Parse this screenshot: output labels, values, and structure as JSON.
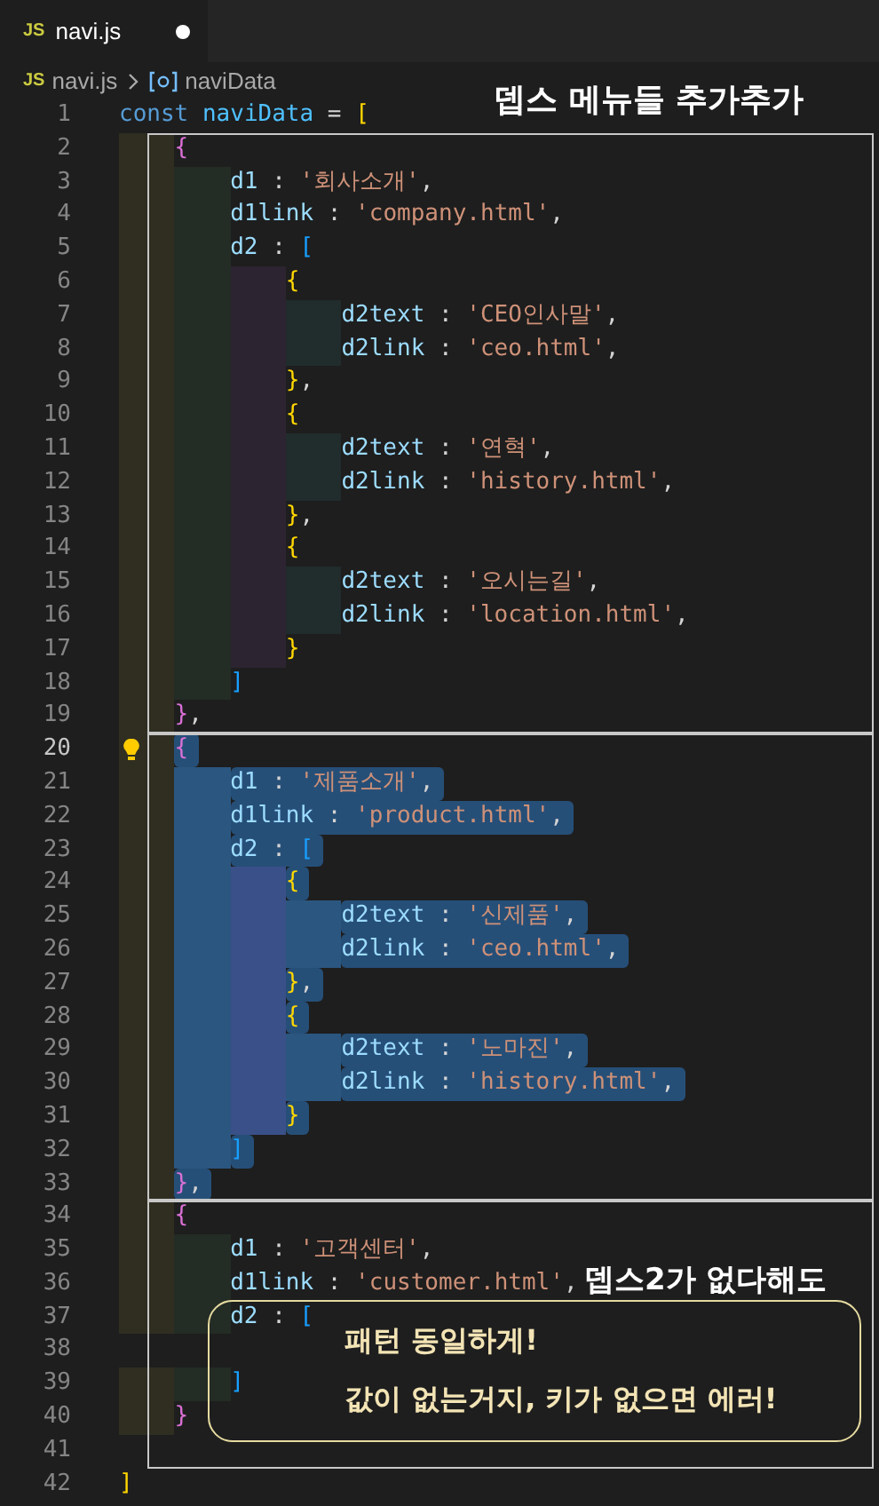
{
  "tab": {
    "badge": "JS",
    "label": "navi.js",
    "modified": true,
    "selected": true
  },
  "breadcrumb": {
    "badge": "JS",
    "file": "navi.js",
    "symbol": "naviData"
  },
  "blocks": [
    {
      "outlined": false,
      "lines": [
        {
          "number": "1",
          "selected": false,
          "current": false,
          "tokens": [
            {
              "text": "const",
              "kind": "keyword"
            },
            {
              "text": " naviData",
              "kind": "variable"
            },
            {
              "text": " = ",
              "kind": "punct"
            },
            {
              "text": "[",
              "kind": "bracket_gold"
            }
          ]
        }
      ]
    },
    {
      "outlined": true,
      "lines": [
        {
          "number": "2",
          "selected": false,
          "current": false,
          "tokens": [
            {
              "text": "    {",
              "kind": "bracket_pink"
            }
          ]
        },
        {
          "number": "3",
          "selected": false,
          "current": false,
          "tokens": [
            {
              "text": "        d1",
              "kind": "prop"
            },
            {
              "text": " : ",
              "kind": "punct"
            },
            {
              "text": "'회사소개'",
              "kind": "string"
            },
            {
              "text": ",",
              "kind": "punct"
            }
          ]
        },
        {
          "number": "4",
          "selected": false,
          "current": false,
          "tokens": [
            {
              "text": "        d1link",
              "kind": "prop"
            },
            {
              "text": " : ",
              "kind": "punct"
            },
            {
              "text": "'company.html'",
              "kind": "string"
            },
            {
              "text": ",",
              "kind": "punct"
            }
          ]
        },
        {
          "number": "5",
          "selected": false,
          "current": false,
          "tokens": [
            {
              "text": "        d2",
              "kind": "prop"
            },
            {
              "text": " : ",
              "kind": "punct"
            },
            {
              "text": "[",
              "kind": "bracket_blue"
            }
          ]
        },
        {
          "number": "6",
          "selected": false,
          "current": false,
          "tokens": [
            {
              "text": "            {",
              "kind": "bracket_gold"
            }
          ]
        },
        {
          "number": "7",
          "selected": false,
          "current": false,
          "tokens": [
            {
              "text": "                d2text",
              "kind": "prop"
            },
            {
              "text": " : ",
              "kind": "punct"
            },
            {
              "text": "'CEO인사말'",
              "kind": "string"
            },
            {
              "text": ",",
              "kind": "punct"
            }
          ]
        },
        {
          "number": "8",
          "selected": false,
          "current": false,
          "tokens": [
            {
              "text": "                d2link",
              "kind": "prop"
            },
            {
              "text": " : ",
              "kind": "punct"
            },
            {
              "text": "'ceo.html'",
              "kind": "string"
            },
            {
              "text": ",",
              "kind": "punct"
            }
          ]
        },
        {
          "number": "9",
          "selected": false,
          "current": false,
          "tokens": [
            {
              "text": "            }",
              "kind": "bracket_gold"
            },
            {
              "text": ",",
              "kind": "punct"
            }
          ]
        },
        {
          "number": "10",
          "selected": false,
          "current": false,
          "tokens": [
            {
              "text": "            {",
              "kind": "bracket_gold"
            }
          ]
        },
        {
          "number": "11",
          "selected": false,
          "current": false,
          "tokens": [
            {
              "text": "                d2text",
              "kind": "prop"
            },
            {
              "text": " : ",
              "kind": "punct"
            },
            {
              "text": "'연혁'",
              "kind": "string"
            },
            {
              "text": ",",
              "kind": "punct"
            }
          ]
        },
        {
          "number": "12",
          "selected": false,
          "current": false,
          "tokens": [
            {
              "text": "                d2link",
              "kind": "prop"
            },
            {
              "text": " : ",
              "kind": "punct"
            },
            {
              "text": "'history.html'",
              "kind": "string"
            },
            {
              "text": ",",
              "kind": "punct"
            }
          ]
        },
        {
          "number": "13",
          "selected": false,
          "current": false,
          "tokens": [
            {
              "text": "            }",
              "kind": "bracket_gold"
            },
            {
              "text": ",",
              "kind": "punct"
            }
          ]
        },
        {
          "number": "14",
          "selected": false,
          "current": false,
          "tokens": [
            {
              "text": "            {",
              "kind": "bracket_gold"
            }
          ]
        },
        {
          "number": "15",
          "selected": false,
          "current": false,
          "tokens": [
            {
              "text": "                d2text",
              "kind": "prop"
            },
            {
              "text": " : ",
              "kind": "punct"
            },
            {
              "text": "'오시는길'",
              "kind": "string"
            },
            {
              "text": ",",
              "kind": "punct"
            }
          ]
        },
        {
          "number": "16",
          "selected": false,
          "current": false,
          "tokens": [
            {
              "text": "                d2link",
              "kind": "prop"
            },
            {
              "text": " : ",
              "kind": "punct"
            },
            {
              "text": "'location.html'",
              "kind": "string"
            },
            {
              "text": ",",
              "kind": "punct"
            }
          ]
        },
        {
          "number": "17",
          "selected": false,
          "current": false,
          "tokens": [
            {
              "text": "            }",
              "kind": "bracket_gold"
            }
          ]
        },
        {
          "number": "18",
          "selected": false,
          "current": false,
          "tokens": [
            {
              "text": "        ]",
              "kind": "bracket_blue"
            }
          ]
        },
        {
          "number": "19",
          "selected": false,
          "current": false,
          "tokens": [
            {
              "text": "    }",
              "kind": "bracket_pink"
            },
            {
              "text": ",",
              "kind": "punct"
            }
          ]
        }
      ]
    },
    {
      "outlined": true,
      "lines": [
        {
          "number": "20",
          "selected": true,
          "current": true,
          "tokens": [
            {
              "text": "    {",
              "kind": "bracket_pink"
            }
          ]
        },
        {
          "number": "21",
          "selected": true,
          "current": false,
          "tokens": [
            {
              "text": "        d1",
              "kind": "prop"
            },
            {
              "text": " : ",
              "kind": "punct"
            },
            {
              "text": "'제품소개'",
              "kind": "string"
            },
            {
              "text": ",",
              "kind": "punct"
            }
          ]
        },
        {
          "number": "22",
          "selected": true,
          "current": false,
          "tokens": [
            {
              "text": "        d1link",
              "kind": "prop"
            },
            {
              "text": " : ",
              "kind": "punct"
            },
            {
              "text": "'product.html'",
              "kind": "string"
            },
            {
              "text": ",",
              "kind": "punct"
            }
          ]
        },
        {
          "number": "23",
          "selected": true,
          "current": false,
          "tokens": [
            {
              "text": "        d2",
              "kind": "prop"
            },
            {
              "text": " : ",
              "kind": "punct"
            },
            {
              "text": "[",
              "kind": "bracket_blue"
            }
          ]
        },
        {
          "number": "24",
          "selected": true,
          "current": false,
          "tokens": [
            {
              "text": "            {",
              "kind": "bracket_gold"
            }
          ]
        },
        {
          "number": "25",
          "selected": true,
          "current": false,
          "tokens": [
            {
              "text": "                d2text",
              "kind": "prop"
            },
            {
              "text": " : ",
              "kind": "punct"
            },
            {
              "text": "'신제품'",
              "kind": "string"
            },
            {
              "text": ",",
              "kind": "punct"
            }
          ]
        },
        {
          "number": "26",
          "selected": true,
          "current": false,
          "tokens": [
            {
              "text": "                d2link",
              "kind": "prop"
            },
            {
              "text": " : ",
              "kind": "punct"
            },
            {
              "text": "'ceo.html'",
              "kind": "string"
            },
            {
              "text": ",",
              "kind": "punct"
            }
          ]
        },
        {
          "number": "27",
          "selected": true,
          "current": false,
          "tokens": [
            {
              "text": "            }",
              "kind": "bracket_gold"
            },
            {
              "text": ",",
              "kind": "punct"
            }
          ]
        },
        {
          "number": "28",
          "selected": true,
          "current": false,
          "tokens": [
            {
              "text": "            {",
              "kind": "bracket_gold"
            }
          ]
        },
        {
          "number": "29",
          "selected": true,
          "current": false,
          "tokens": [
            {
              "text": "                d2text",
              "kind": "prop"
            },
            {
              "text": " : ",
              "kind": "punct"
            },
            {
              "text": "'노마진'",
              "kind": "string"
            },
            {
              "text": ",",
              "kind": "punct"
            }
          ]
        },
        {
          "number": "30",
          "selected": true,
          "current": false,
          "tokens": [
            {
              "text": "                d2link",
              "kind": "prop"
            },
            {
              "text": " : ",
              "kind": "punct"
            },
            {
              "text": "'history.html'",
              "kind": "string"
            },
            {
              "text": ",",
              "kind": "punct"
            }
          ]
        },
        {
          "number": "31",
          "selected": true,
          "current": false,
          "tokens": [
            {
              "text": "            }",
              "kind": "bracket_gold"
            }
          ]
        },
        {
          "number": "32",
          "selected": true,
          "current": false,
          "tokens": [
            {
              "text": "        ]",
              "kind": "bracket_blue"
            }
          ]
        },
        {
          "number": "33",
          "selected": true,
          "current": false,
          "tokens": [
            {
              "text": "    }",
              "kind": "bracket_pink"
            },
            {
              "text": ",",
              "kind": "punct"
            }
          ]
        }
      ]
    },
    {
      "outlined": true,
      "lines": [
        {
          "number": "34",
          "selected": false,
          "current": false,
          "tokens": [
            {
              "text": "    {",
              "kind": "bracket_pink"
            }
          ]
        },
        {
          "number": "35",
          "selected": false,
          "current": false,
          "tokens": [
            {
              "text": "        d1",
              "kind": "prop"
            },
            {
              "text": " : ",
              "kind": "punct"
            },
            {
              "text": "'고객센터'",
              "kind": "string"
            },
            {
              "text": ",",
              "kind": "punct"
            }
          ]
        },
        {
          "number": "36",
          "selected": false,
          "current": false,
          "tokens": [
            {
              "text": "        d1link",
              "kind": "prop"
            },
            {
              "text": " : ",
              "kind": "punct"
            },
            {
              "text": "'customer.html'",
              "kind": "string"
            },
            {
              "text": ",",
              "kind": "punct"
            }
          ]
        },
        {
          "number": "37",
          "selected": false,
          "current": false,
          "tokens": [
            {
              "text": "        d2",
              "kind": "prop"
            },
            {
              "text": " : ",
              "kind": "punct"
            },
            {
              "text": "[",
              "kind": "bracket_blue"
            }
          ]
        },
        {
          "number": "38",
          "selected": false,
          "current": false
        },
        {
          "number": "39",
          "selected": false,
          "current": false,
          "tokens": [
            {
              "text": "        ]",
              "kind": "bracket_blue"
            }
          ]
        },
        {
          "number": "40",
          "selected": false,
          "current": false,
          "tokens": [
            {
              "text": "    }",
              "kind": "bracket_pink"
            }
          ]
        },
        {
          "number": "41",
          "selected": false,
          "current": false
        }
      ]
    },
    {
      "outlined": false,
      "lines": [
        {
          "number": "42",
          "selected": false,
          "current": false,
          "tokens": [
            {
              "text": "]",
              "kind": "bracket_gold"
            }
          ]
        }
      ]
    }
  ],
  "annotations": {
    "heading": "뎁스 메뉴들 추가추가",
    "side_note": "뎁스2가 없다해도",
    "callout": [
      "패턴 동일하게!",
      "값이 없는거지, 키가 없으면 에러!"
    ]
  }
}
